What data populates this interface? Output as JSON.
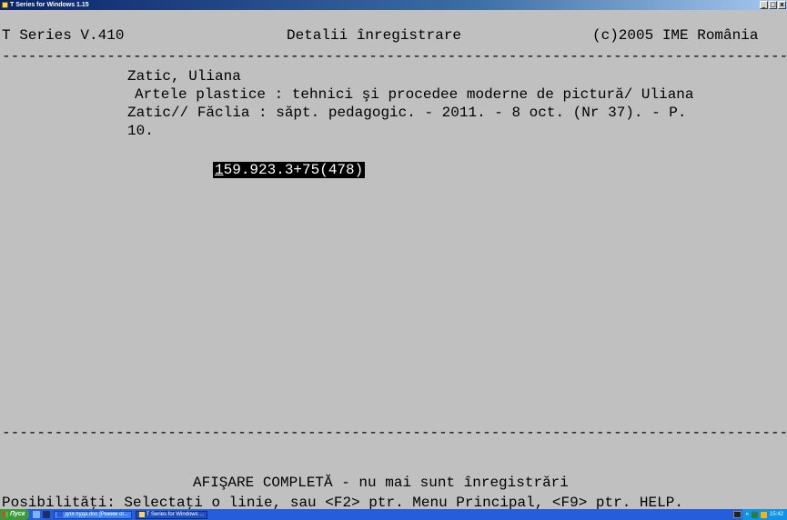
{
  "window": {
    "title": "T Series for Windows 1.15",
    "buttons": {
      "minimize": "_",
      "maximize": "□",
      "close": "x"
    }
  },
  "header": {
    "app_version": "T Series V.410",
    "screen_title": "Detalii înregistrare",
    "copyright": "(c)2005 IME România"
  },
  "separator": "------------------------------------------------------------------------------------------------------",
  "record": {
    "author": "Zatic, Uliana",
    "lines": [
      "Artele plastice : tehnici şi procedee moderne de pictură/ Uliana",
      "Zatic// Făclia : săpt. pedagogic. - 2011. - 8 oct. (Nr 37). - P.",
      "10."
    ],
    "classification_cursor": "1",
    "classification_rest": "59.923.3+75(478)"
  },
  "footer": {
    "status": "AFIŞARE COMPLETĂ - nu mai sunt înregistrări",
    "options": "Posibilităţi: Selectaţi o linie, sau <F2> ptr. Menu Principal, <F9> ptr. HELP."
  },
  "taskbar": {
    "start_label": "Пуск",
    "tasks": [
      {
        "label": "для пуда.doc [Режим ог..."
      },
      {
        "label": "T Series for Windows ..."
      }
    ],
    "tray_chevron": "«",
    "clock": "15:42"
  },
  "colors": {
    "terminal_bg": "#c0c0c0",
    "titlebar": "#0a246a",
    "taskbar": "#245edb",
    "highlight_bg": "#000000",
    "highlight_fg": "#ffffff"
  }
}
